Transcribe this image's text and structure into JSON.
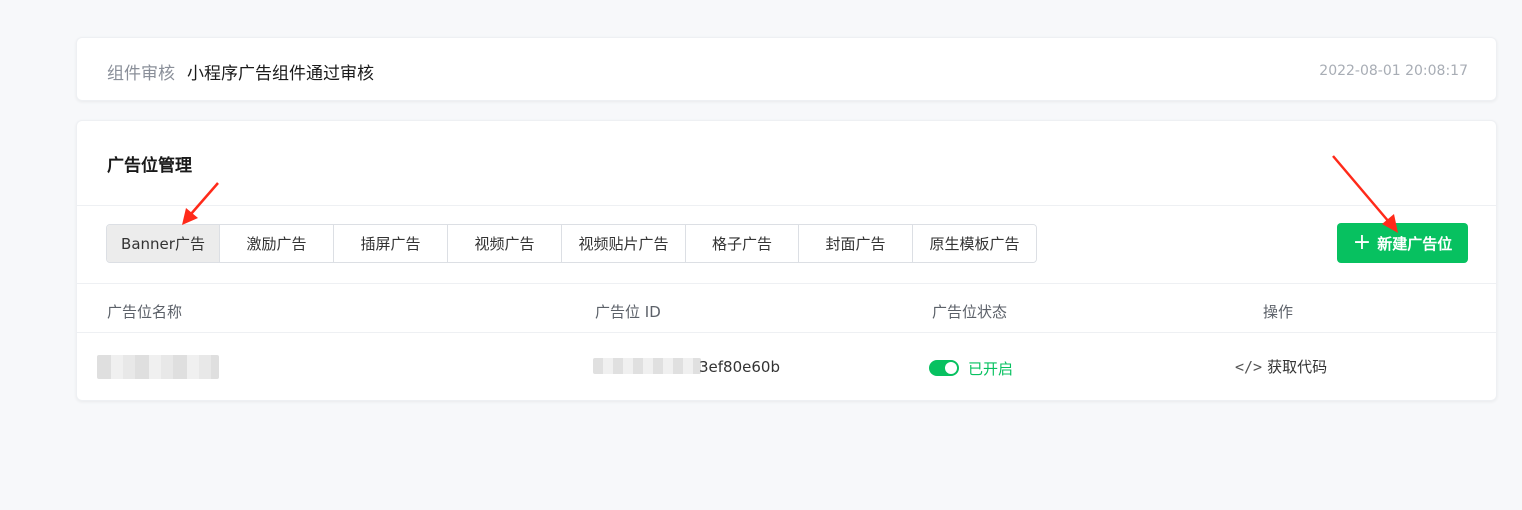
{
  "notice": {
    "label": "组件审核",
    "text": "小程序广告组件通过审核",
    "time": "2022-08-01 20:08:17"
  },
  "ad_management": {
    "title": "广告位管理",
    "tabs": [
      {
        "label": "Banner广告",
        "active": true
      },
      {
        "label": "激励广告",
        "active": false
      },
      {
        "label": "插屏广告",
        "active": false
      },
      {
        "label": "视频广告",
        "active": false
      },
      {
        "label": "视频贴片广告",
        "active": false
      },
      {
        "label": "格子广告",
        "active": false
      },
      {
        "label": "封面广告",
        "active": false
      },
      {
        "label": "原生模板广告",
        "active": false
      }
    ],
    "new_button_label": "新建广告位",
    "table": {
      "headers": [
        "广告位名称",
        "广告位 ID",
        "广告位状态",
        "操作"
      ],
      "rows": [
        {
          "name": "",
          "id_visible_suffix": "3ef80e60b",
          "status": "已开启",
          "action": "获取代码"
        }
      ]
    }
  },
  "colors": {
    "accent": "#07c160",
    "annotation_arrow": "#ff2a1a"
  },
  "icons": {
    "plus": "plus-icon",
    "code": "code-icon",
    "toggle": "toggle-on-icon"
  }
}
